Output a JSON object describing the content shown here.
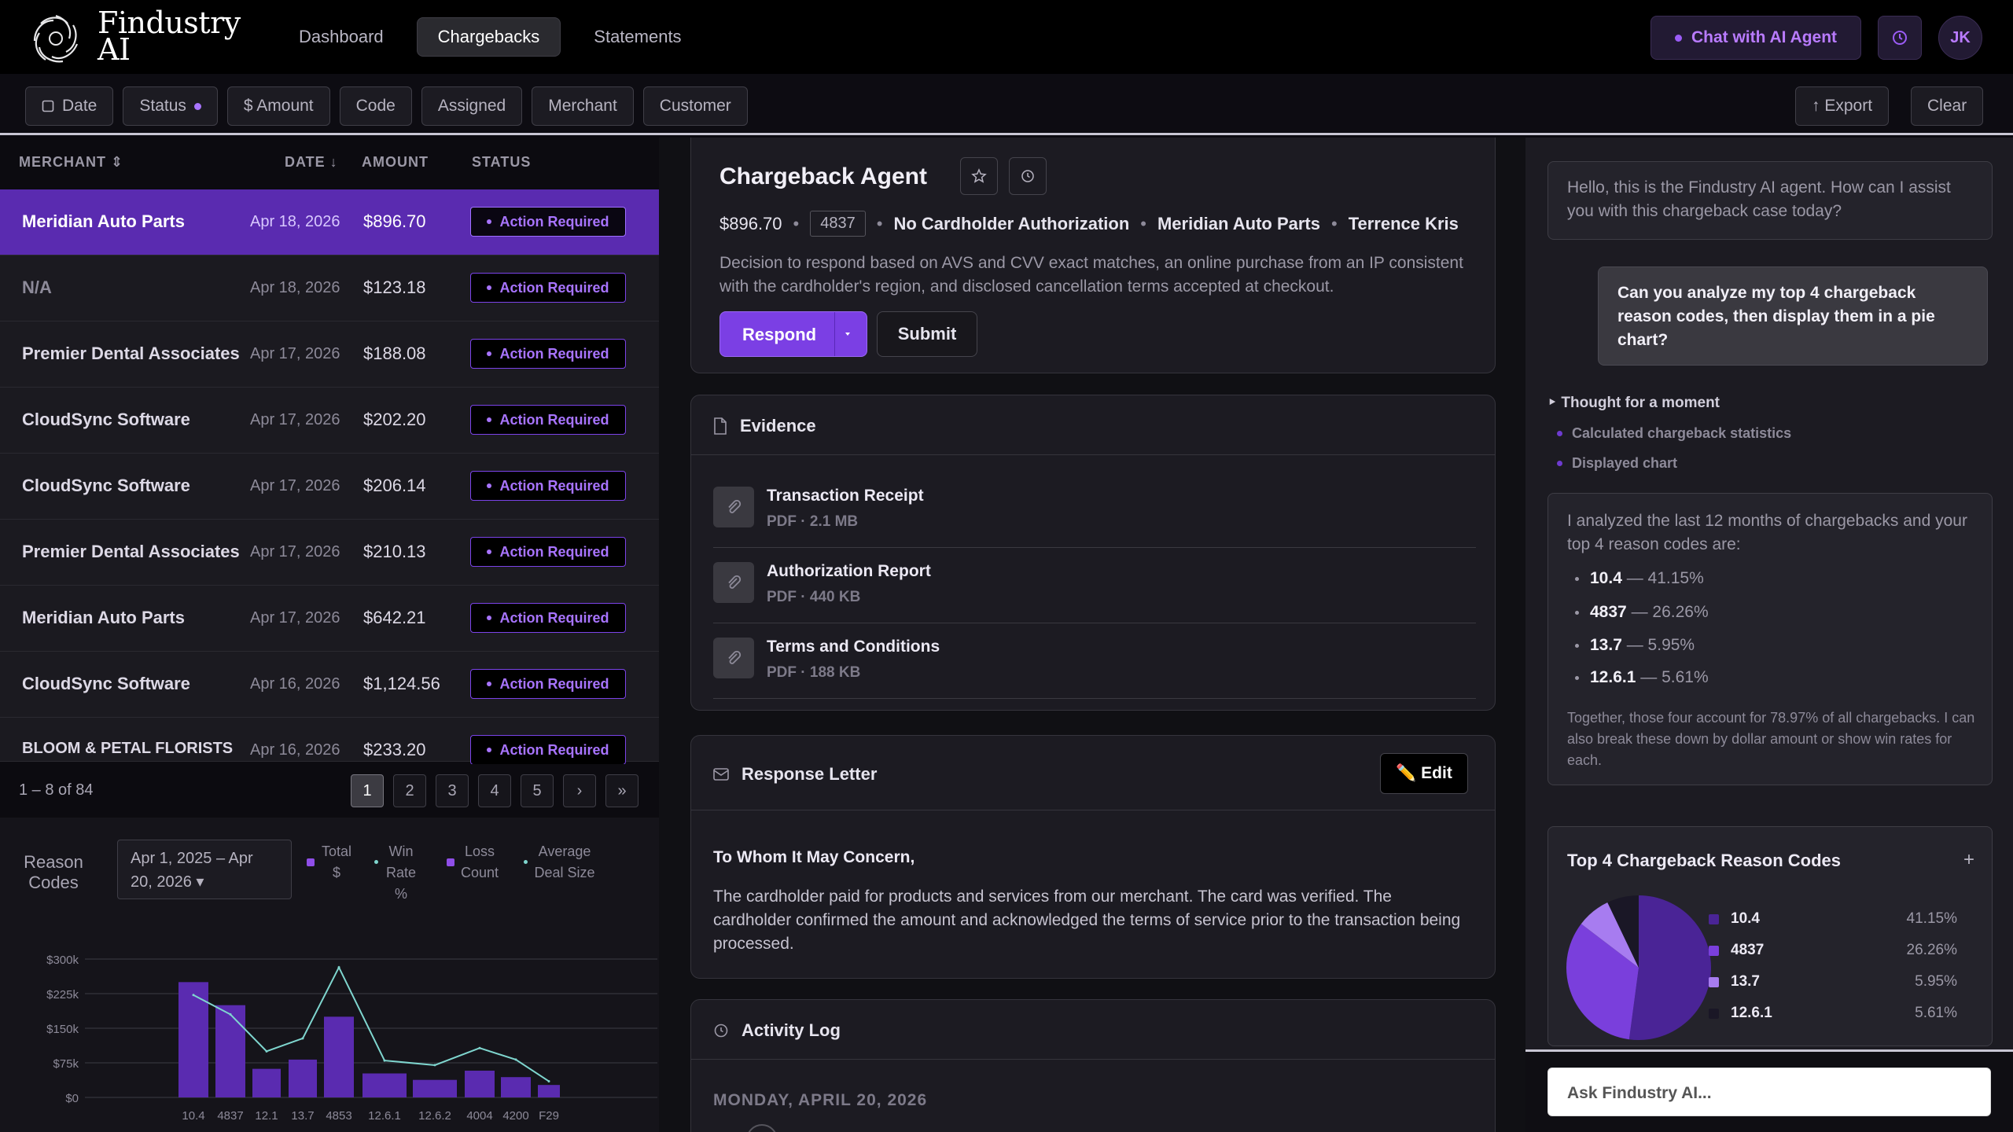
{
  "app": {
    "logo_line1": "Findustry",
    "logo_line2": "AI"
  },
  "nav": {
    "items": [
      "Dashboard",
      "Chargebacks",
      "Statements"
    ],
    "active": "Chargebacks"
  },
  "header": {
    "chat_button": "Chat with AI Agent",
    "user_initials": "JK"
  },
  "filters": {
    "date": "Date",
    "status": "Status",
    "amount": "$ Amount",
    "code": "Code",
    "assigned": "Assigned",
    "merchant": "Merchant",
    "customer": "Customer",
    "export": "↑ Export",
    "clear": "Clear"
  },
  "table": {
    "columns": {
      "merchant": "MERCHANT ⇕",
      "date": "DATE ↓",
      "amount": "AMOUNT",
      "status": "STATUS"
    },
    "rows": [
      {
        "merchant": "Meridian Auto Parts",
        "date": "Apr 18, 2026",
        "amount": "$896.70",
        "status": "Action Required"
      },
      {
        "merchant": "N/A",
        "date": "Apr 18, 2026",
        "amount": "$123.18",
        "status": "Action Required"
      },
      {
        "merchant": "Premier Dental Associates",
        "date": "Apr 17, 2026",
        "amount": "$188.08",
        "status": "Action Required"
      },
      {
        "merchant": "CloudSync Software",
        "date": "Apr 17, 2026",
        "amount": "$202.20",
        "status": "Action Required"
      },
      {
        "merchant": "CloudSync Software",
        "date": "Apr 17, 2026",
        "amount": "$206.14",
        "status": "Action Required"
      },
      {
        "merchant": "Premier Dental Associates",
        "date": "Apr 17, 2026",
        "amount": "$210.13",
        "status": "Action Required"
      },
      {
        "merchant": "Meridian Auto Parts",
        "date": "Apr 17, 2026",
        "amount": "$642.21",
        "status": "Action Required"
      },
      {
        "merchant": "CloudSync Software",
        "date": "Apr 16, 2026",
        "amount": "$1,124.56",
        "status": "Action Required"
      },
      {
        "merchant": "BLOOM & PETAL FLORISTS",
        "date": "Apr 16, 2026",
        "amount": "$233.20",
        "status": "Action Required"
      }
    ],
    "pagination": {
      "summary": "1 – 8 of 84",
      "pages": [
        "1",
        "2",
        "3",
        "4",
        "5",
        "›",
        "»"
      ],
      "current": "1"
    }
  },
  "reason_codes": {
    "title": "Reason Codes",
    "date_range": "Apr 1, 2025 – Apr 20, 2026 ▾",
    "legend": [
      "Total $",
      "Win Rate %",
      "Loss Count",
      "Average Deal Size"
    ]
  },
  "chart_data": {
    "type": "bar",
    "title": "Reason Codes",
    "categories": [
      "10.4",
      "4837",
      "12.1",
      "13.7",
      "4853",
      "12.6.1",
      "12.6.2",
      "4004",
      "4200",
      "F29"
    ],
    "series": [
      {
        "name": "Total $",
        "type": "bar",
        "values": [
          250000,
          200000,
          62000,
          82000,
          175000,
          52000,
          38000,
          58000,
          44000,
          27000
        ]
      },
      {
        "name": "Win Rate %",
        "type": "line",
        "values": [
          222000,
          180000,
          100000,
          128000,
          282000,
          80000,
          70000,
          107000,
          82000,
          35000
        ]
      }
    ],
    "yticks": [
      "$0",
      "$75k",
      "$150k",
      "$225k",
      "$300k"
    ],
    "ylim": [
      0,
      300000
    ],
    "grid": true,
    "colors": {
      "bar": "#5a2bb0",
      "line": "#7fd6cf",
      "loss": "#8f4ee8"
    }
  },
  "agent": {
    "title": "Chargeback Agent",
    "amount": "$896.70",
    "code": "4837",
    "reason": "No Cardholder Authorization",
    "merchant": "Meridian Auto Parts",
    "customer": "Terrence Kris",
    "description": "Decision to respond based on AVS and CVV exact matches, an online purchase from an IP consistent with the cardholder's region, and disclosed cancellation terms accepted at checkout.",
    "respond": "Respond",
    "submit": "Submit"
  },
  "evidence": {
    "title": "Evidence",
    "files": [
      {
        "name": "Transaction Receipt",
        "size": "PDF · 2.1 MB"
      },
      {
        "name": "Authorization Report",
        "size": "PDF · 440 KB"
      },
      {
        "name": "Terms and Conditions",
        "size": "PDF · 188 KB"
      }
    ]
  },
  "letter": {
    "title": "Response Letter",
    "edit": "✏️ Edit",
    "salutation": "To Whom It May Concern,",
    "body": "The cardholder paid for products and services from our merchant. The card was verified. The cardholder confirmed the amount and acknowledged the terms of service prior to the transaction being processed."
  },
  "activity": {
    "title": "Activity Log",
    "date": "MONDAY, APRIL 20, 2026"
  },
  "chat": {
    "greeting": "Hello, this is the Findustry AI agent. How can I assist you with this chargeback case today?",
    "user_msg": "Can you analyze my top 4 chargeback reason codes, then display them in a pie chart?",
    "thought": "‣ Thought for a moment",
    "steps": [
      "Calculated chargeback statistics",
      "Displayed chart"
    ],
    "answer_intro": "I analyzed the last 12 months of chargebacks and your top 4 reason codes are:",
    "answer_items": [
      {
        "code": "10.4",
        "pct": "— 41.15%"
      },
      {
        "code": "4837",
        "pct": "— 26.26%"
      },
      {
        "code": "13.7",
        "pct": "— 5.95%"
      },
      {
        "code": "12.6.1",
        "pct": "— 5.61%"
      }
    ],
    "answer_summary": "Together, those four account for 78.97% of all chargebacks. I can also break these down by dollar amount or show win rates for each.",
    "pie": {
      "title": "Top 4 Chargeback Reason Codes",
      "plus": "+",
      "slices": [
        {
          "label": "10.4",
          "pct": "41.15%",
          "value": 41.15,
          "color": "#4a2496"
        },
        {
          "label": "4837",
          "pct": "26.26%",
          "value": 26.26,
          "color": "#7a3fdc"
        },
        {
          "label": "13.7",
          "pct": "5.95%",
          "value": 5.95,
          "color": "#a77cf0"
        },
        {
          "label": "12.6.1",
          "pct": "5.61%",
          "value": 5.61,
          "color": "#1a1726"
        }
      ]
    },
    "input_placeholder": "Ask Findustry AI..."
  }
}
